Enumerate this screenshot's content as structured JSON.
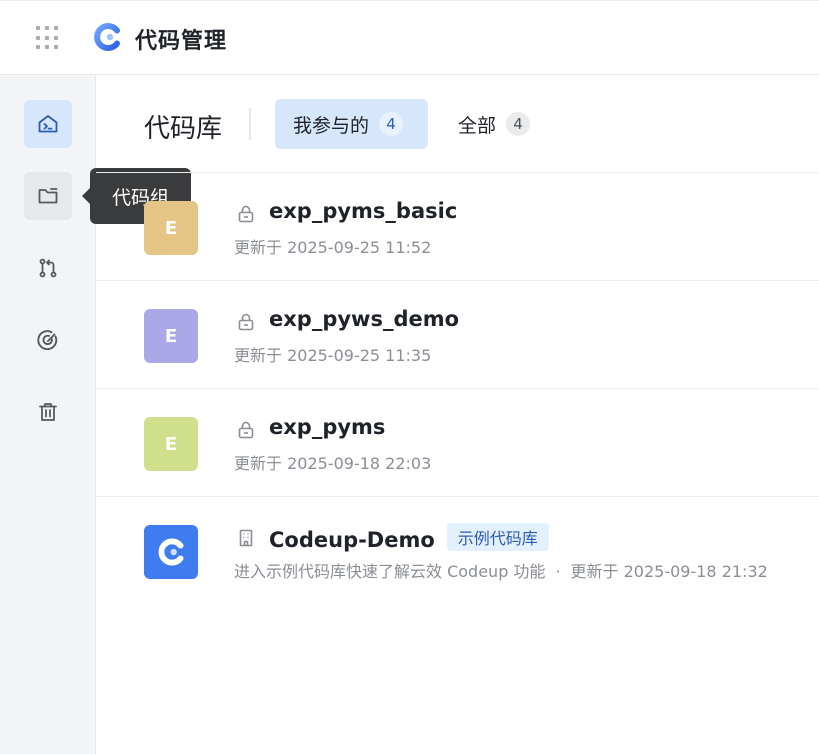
{
  "app": {
    "title": "代码管理",
    "icons": {
      "apps": "grid-dots-icon",
      "logo": "codeup-logo-icon"
    }
  },
  "sidebar": {
    "items": [
      {
        "name": "home",
        "icon": "code-home-icon",
        "active": true
      },
      {
        "name": "code-group",
        "icon": "folder-icon",
        "hover": true
      },
      {
        "name": "merge-requests",
        "icon": "merge-request-icon"
      },
      {
        "name": "insights",
        "icon": "target-icon"
      },
      {
        "name": "trash",
        "icon": "trash-icon"
      }
    ],
    "tooltip": "代码组"
  },
  "main": {
    "section_title": "代码库",
    "tabs": [
      {
        "label": "我参与的",
        "count": "4",
        "active": true
      },
      {
        "label": "全部",
        "count": "4",
        "active": false
      }
    ],
    "repos": [
      {
        "initial": "E",
        "name": "exp_pyms_basic",
        "visibility_icon": "lock-icon",
        "updated": "更新于 2025-09-25 11:52",
        "color": "#e5c585"
      },
      {
        "initial": "E",
        "name": "exp_pyws_demo",
        "visibility_icon": "lock-icon",
        "updated": "更新于 2025-09-25 11:35",
        "color": "#aaa8e6"
      },
      {
        "initial": "E",
        "name": "exp_pyms",
        "visibility_icon": "lock-icon",
        "updated": "更新于 2025-09-18 22:03",
        "color": "#cfdf8c"
      },
      {
        "initial": "",
        "name": "Codeup-Demo",
        "visibility_icon": "building-icon",
        "tag": "示例代码库",
        "description": "进入示例代码库快速了解云效 Codeup 功能",
        "separator": "·",
        "updated": "更新于 2025-09-18 21:32",
        "color": "#3e7cf0"
      }
    ]
  },
  "colors": {
    "accent": "#2d5bb8",
    "active_bg": "#d6e6fb",
    "sidebar_bg": "#f3f4f6"
  }
}
